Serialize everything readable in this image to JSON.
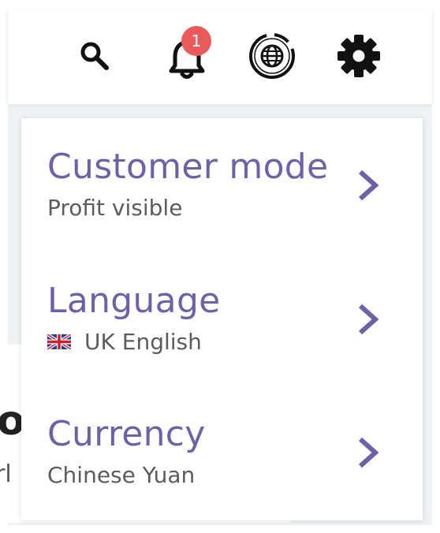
{
  "colors": {
    "accent": "#7060a8",
    "subtext": "#5c5c5c",
    "badge": "#ea5a5a",
    "icon": "#111111"
  },
  "header": {
    "icons": [
      "search-icon",
      "bell-icon",
      "globe-icon",
      "gear-icon"
    ],
    "notification_count": "1"
  },
  "background": {
    "fragment_1": "o",
    "fragment_2": "rl"
  },
  "menu": {
    "items": [
      {
        "title": "Customer mode",
        "subtitle": "Profit visible"
      },
      {
        "title": "Language",
        "subtitle": "UK English",
        "flag": "uk-flag-icon"
      },
      {
        "title": "Currency",
        "subtitle": "Chinese Yuan"
      }
    ]
  }
}
